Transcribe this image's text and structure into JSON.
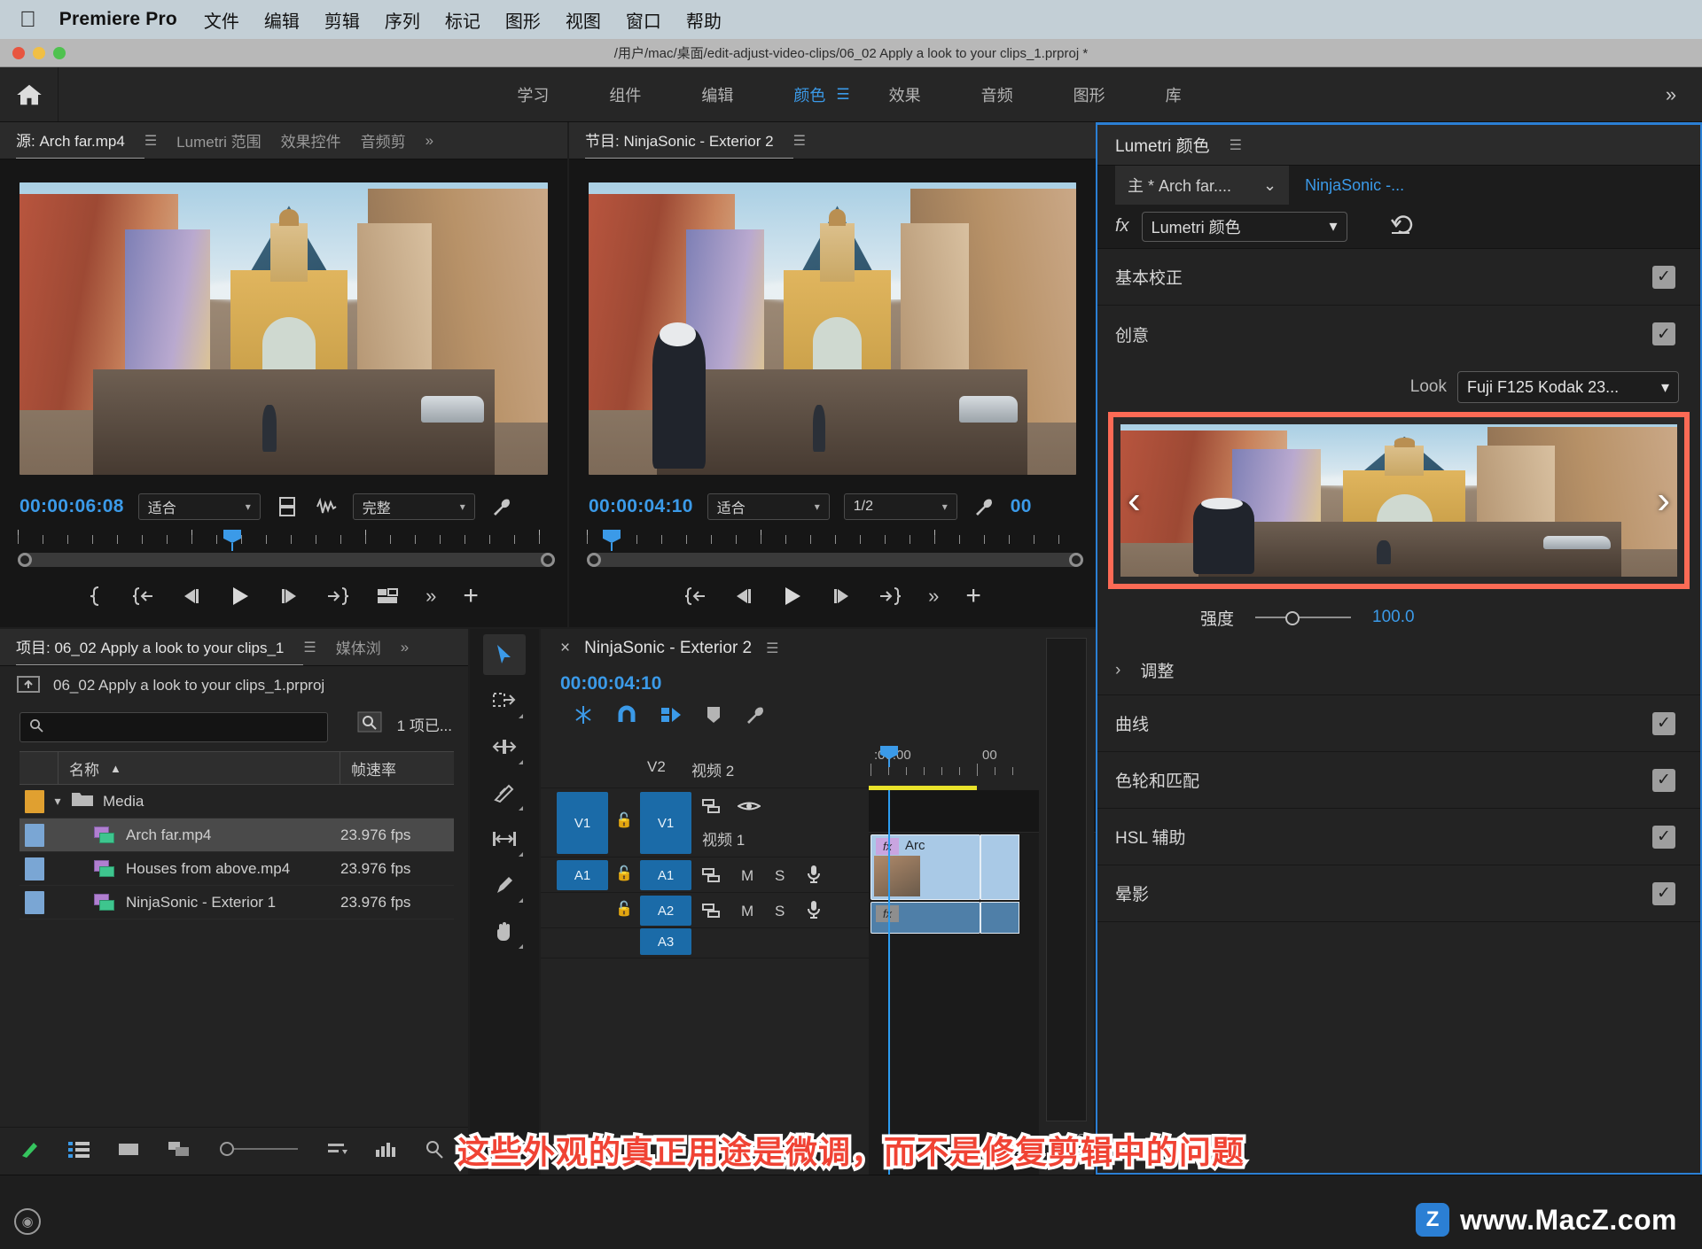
{
  "macbar": {
    "apple_icon": "apple-icon",
    "app_name": "Premiere Pro",
    "menus": [
      "文件",
      "编辑",
      "剪辑",
      "序列",
      "标记",
      "图形",
      "视图",
      "窗口",
      "帮助"
    ]
  },
  "titlebar": {
    "path": "/用户/mac/桌面/edit-adjust-video-clips/06_02 Apply a look to your clips_1.prproj *"
  },
  "workspace": {
    "home_icon": "home-icon",
    "tabs": [
      {
        "label": "学习",
        "active": false
      },
      {
        "label": "组件",
        "active": false
      },
      {
        "label": "编辑",
        "active": false
      },
      {
        "label": "颜色",
        "active": true
      },
      {
        "label": "效果",
        "active": false
      },
      {
        "label": "音频",
        "active": false
      },
      {
        "label": "图形",
        "active": false
      },
      {
        "label": "库",
        "active": false
      }
    ],
    "more": "»"
  },
  "source_monitor": {
    "tabs": [
      {
        "label": "源: Arch far.mp4",
        "active": true
      },
      {
        "label": "Lumetri 范围",
        "active": false
      },
      {
        "label": "效果控件",
        "active": false
      },
      {
        "label": "音频剪",
        "active": false
      }
    ],
    "more": "»",
    "timecode": "00:00:06:08",
    "fit_select": "适合",
    "fit_chevron": "⌄",
    "export_frame_icon": "export-frame-icon",
    "audio_icon": "audio-waveform-icon",
    "quality_select": "完整",
    "settings_icon": "wrench-icon",
    "transport": [
      "mark-in-out-icon",
      "go-to-in-icon",
      "step-back-icon",
      "play-icon",
      "step-forward-icon",
      "go-to-out-icon",
      "insert-icon",
      "more-icon",
      "add-icon"
    ]
  },
  "program_monitor": {
    "tab": "节目: NinjaSonic - Exterior 2",
    "hamburger": "☰",
    "timecode": "00:00:04:10",
    "fit_select": "适合",
    "res_select": "1/2",
    "settings_icon": "wrench-icon",
    "extra_timecode": "00",
    "transport": [
      "go-to-in-icon",
      "step-back-icon",
      "play-icon",
      "step-forward-icon",
      "go-to-out-icon",
      "more-icon",
      "add-icon"
    ]
  },
  "project_panel": {
    "tabs": [
      {
        "label": "项目: 06_02 Apply a look to your clips_1",
        "active": true
      },
      {
        "label": "媒体浏",
        "active": false
      }
    ],
    "more": "»",
    "project_file": "06_02 Apply a look to your clips_1.prproj",
    "parent_icon": "go-up-folder-icon",
    "search_placeholder": "",
    "search_value": "",
    "find_icon": "find-icon",
    "item_count": "1 项已...",
    "columns": [
      "名称",
      "帧速率"
    ],
    "sort_icon": "▲",
    "rows": [
      {
        "type": "bin",
        "swatch": "#e0a030",
        "name": "Media",
        "fps": "",
        "expanded": true,
        "selected": false
      },
      {
        "type": "clip",
        "swatch": "#7aa6d4",
        "name": "Arch far.mp4",
        "fps": "23.976 fps",
        "selected": true
      },
      {
        "type": "clip",
        "swatch": "#7aa6d4",
        "name": "Houses from above.mp4",
        "fps": "23.976 fps",
        "selected": false
      },
      {
        "type": "clip",
        "swatch": "#7aa6d4",
        "name": "NinjaSonic - Exterior 1",
        "fps": "23.976 fps",
        "selected": false
      }
    ],
    "footer_icons": [
      "new-item-icon",
      "list-view-icon",
      "icon-view-icon",
      "freeform-view-icon",
      "zoom-slider-icon",
      "sort-icon",
      "automate-icon",
      "find-icon",
      "new-bin-icon"
    ]
  },
  "tools": [
    {
      "name": "selection-tool",
      "glyph": "➤",
      "active": true
    },
    {
      "name": "track-select-forward-tool",
      "glyph": "⇥",
      "active": false
    },
    {
      "name": "ripple-edit-tool",
      "glyph": "⟺",
      "active": false
    },
    {
      "name": "razor-tool",
      "glyph": "✂",
      "active": false
    },
    {
      "name": "slip-tool",
      "glyph": "|↔|",
      "active": false
    },
    {
      "name": "pen-tool",
      "glyph": "✎",
      "active": false
    },
    {
      "name": "hand-tool",
      "glyph": "✋",
      "active": false
    }
  ],
  "timeline": {
    "close_icon": "×",
    "title": "NinjaSonic - Exterior 2",
    "hamburger": "☰",
    "timecode": "00:00:04:10",
    "tool_icons": [
      "linked-selection-icon",
      "snap-icon",
      "marker-sync-icon",
      "marker-icon",
      "wrench-icon"
    ],
    "ruler_labels": [
      ":00:00",
      "00"
    ],
    "tracks": [
      {
        "id": "V2",
        "label": "视频 2",
        "target": "",
        "locked": true
      },
      {
        "id": "V1",
        "label": "视频 1",
        "target": "V1",
        "sync": true,
        "eye": true
      },
      {
        "id": "A1",
        "label": "",
        "target": "A1",
        "m": "M",
        "s": "S",
        "mic": true
      },
      {
        "id": "A2",
        "label": "",
        "target": "A2",
        "m": "M",
        "s": "S",
        "mic": true
      },
      {
        "id": "A3",
        "label": "",
        "target": "A3",
        "m": "",
        "s": "",
        "mic": false
      }
    ],
    "clip_label": "Arc",
    "clip_fx_badge": "fx"
  },
  "lumetri": {
    "panel_title": "Lumetri 颜色",
    "hamburger": "☰",
    "master_label": "主 * Arch far....",
    "master_chevron": "⌄",
    "sequence_link": "NinjaSonic -...",
    "fx_icon": "fx",
    "effect_select": "Lumetri 颜色",
    "reset_icon": "reset-icon",
    "sections": [
      {
        "label": "基本校正",
        "checked": true
      },
      {
        "label": "创意",
        "checked": true
      }
    ],
    "look_label": "Look",
    "look_value": "Fuji F125 Kodak 23...",
    "look_prev_arrow": "‹",
    "look_next_arrow": "›",
    "intensity_label": "强度",
    "intensity_value": "100.0",
    "adjust_label": "调整",
    "adjust_chevron": "›",
    "lower_sections": [
      {
        "label": "曲线",
        "checked": true
      },
      {
        "label": "色轮和匹配",
        "checked": true
      },
      {
        "label": "HSL 辅助",
        "checked": true
      },
      {
        "label": "晕影",
        "checked": true
      }
    ],
    "highlight_color": "#fc6a55"
  },
  "subtitle": {
    "text": "这些外观的真正用途是微调，而不是修复剪辑中的问题"
  },
  "watermark": {
    "logo_letter": "Z",
    "text": "www.MacZ.com"
  },
  "statusbar": {
    "record_icon": "record-icon"
  }
}
